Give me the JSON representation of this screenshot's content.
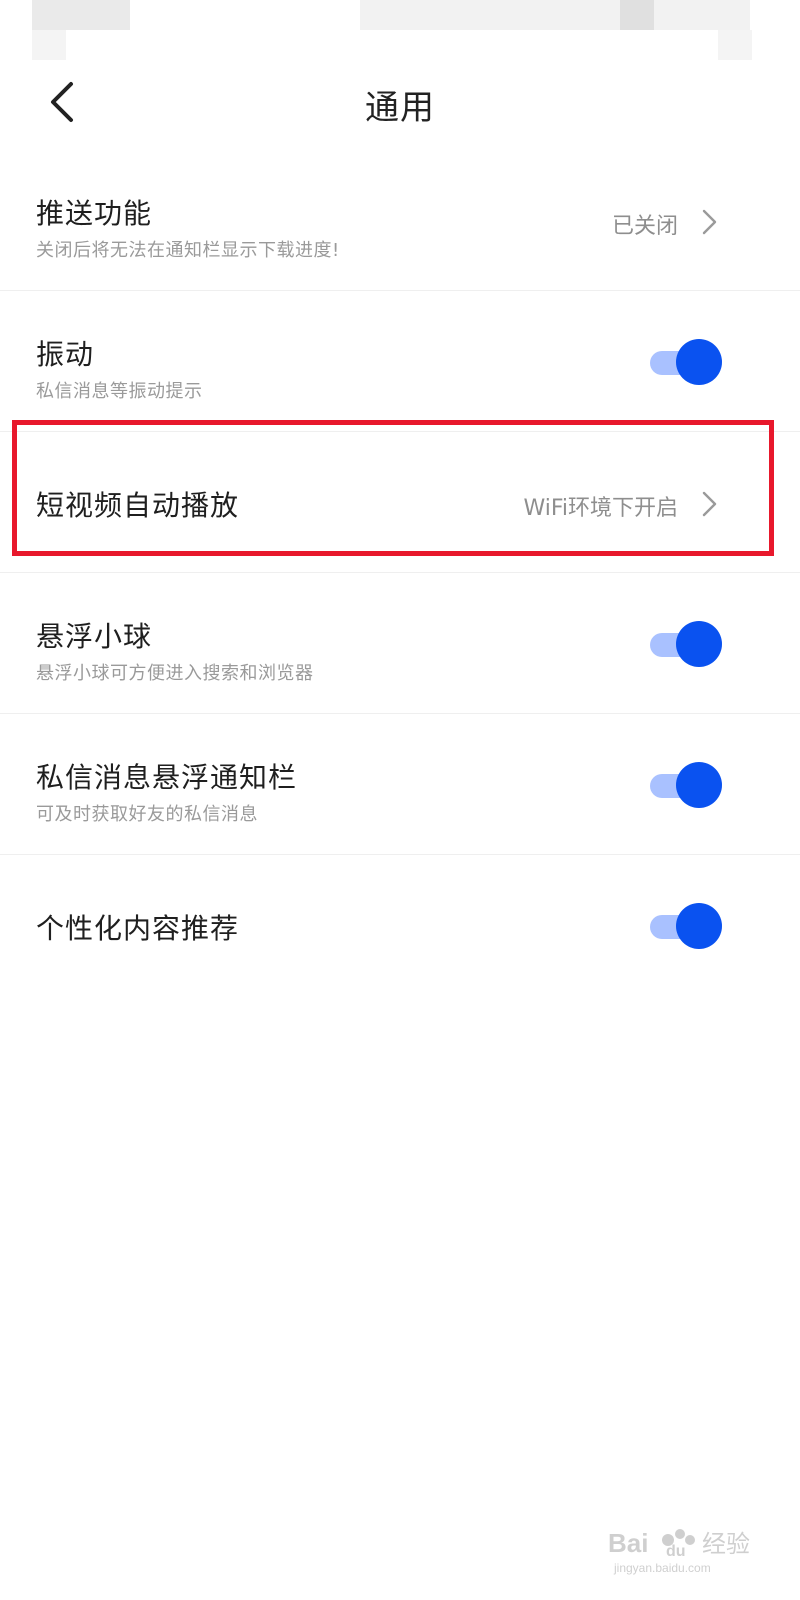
{
  "header": {
    "title": "通用",
    "back_icon": "chevron-left-icon"
  },
  "settings": {
    "push": {
      "title": "推送功能",
      "subtitle": "关闭后将无法在通知栏显示下载进度!",
      "value": "已关闭"
    },
    "vibration": {
      "title": "振动",
      "subtitle": "私信消息等振动提示",
      "enabled": true
    },
    "autoplay": {
      "title": "短视频自动播放",
      "value": "WiFi环境下开启"
    },
    "floating_ball": {
      "title": "悬浮小球",
      "subtitle": "悬浮小球可方便进入搜索和浏览器",
      "enabled": true
    },
    "dm_notification": {
      "title": "私信消息悬浮通知栏",
      "subtitle": "可及时获取好友的私信消息",
      "enabled": true
    },
    "personalized": {
      "title": "个性化内容推荐",
      "enabled": true
    }
  },
  "colors": {
    "toggle_on": "#0a52f0",
    "toggle_track": "#a9c1ff",
    "highlight": "#e8182c"
  },
  "watermark": {
    "brand": "Bai du 经验",
    "url": "jingyan.baidu.com"
  }
}
